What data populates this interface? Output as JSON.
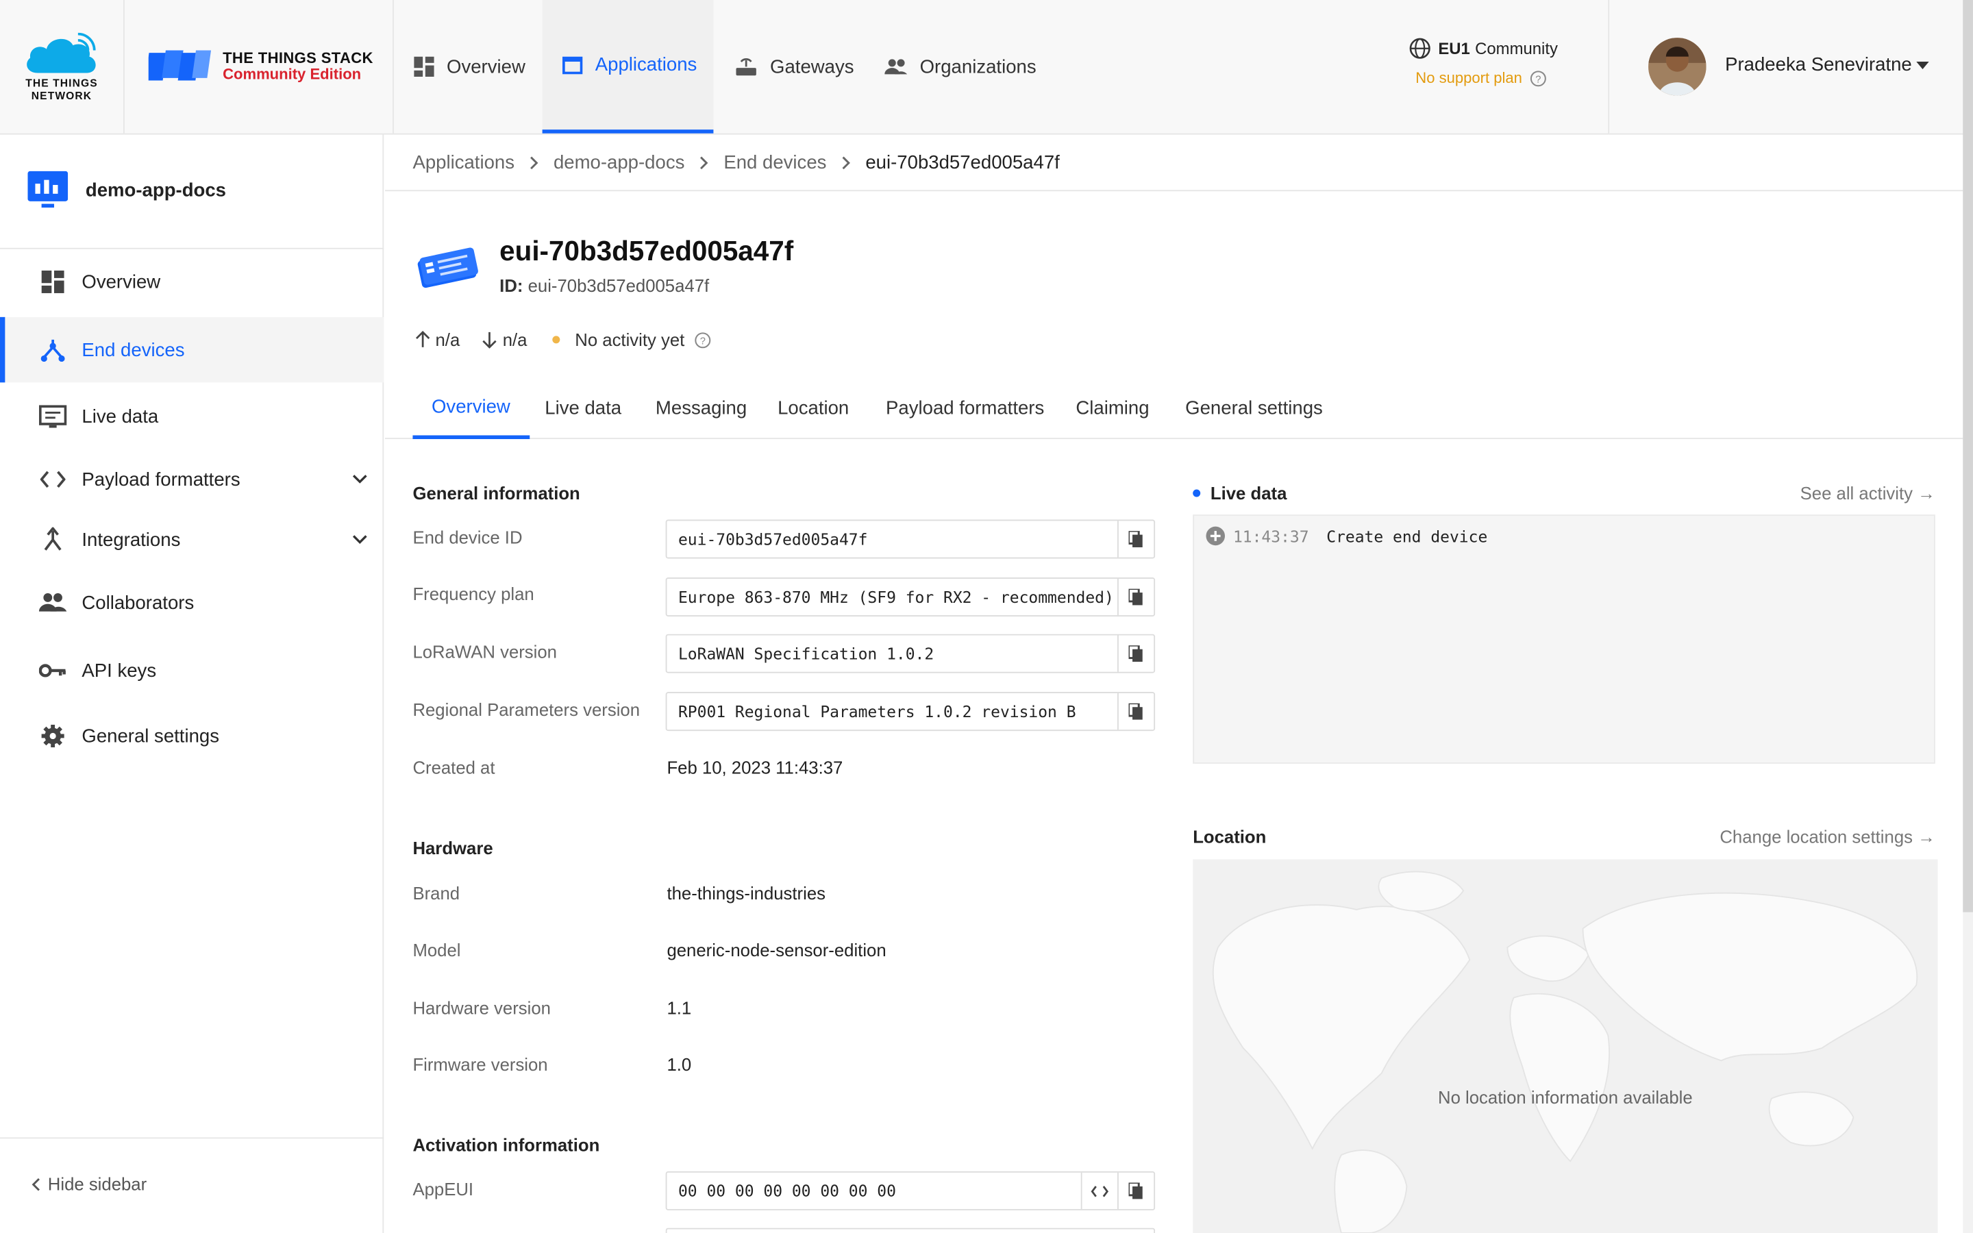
{
  "header": {
    "ttn_logo_text": "THE THINGS\nNETWORK",
    "tts_name": "THE THINGS STACK",
    "tts_edition": "Community Edition",
    "nav": [
      {
        "label": "Overview",
        "icon": "overview-grid-icon"
      },
      {
        "label": "Applications",
        "icon": "application-window-icon",
        "active": true
      },
      {
        "label": "Gateways",
        "icon": "gateway-router-icon"
      },
      {
        "label": "Organizations",
        "icon": "organization-people-icon"
      }
    ],
    "cluster": {
      "region": "EU1",
      "label": "Community",
      "support": "No support plan"
    },
    "user": {
      "name": "Pradeeka Seneviratne"
    }
  },
  "sidebar": {
    "app_name": "demo-app-docs",
    "items": [
      {
        "label": "Overview",
        "icon": "overview-grid-icon"
      },
      {
        "label": "End devices",
        "icon": "end-devices-icon",
        "active": true
      },
      {
        "label": "Live data",
        "icon": "live-data-icon"
      },
      {
        "label": "Payload formatters",
        "icon": "code-icon",
        "expandable": true
      },
      {
        "label": "Integrations",
        "icon": "integrations-icon",
        "expandable": true
      },
      {
        "label": "Collaborators",
        "icon": "collaborators-icon"
      },
      {
        "label": "API keys",
        "icon": "key-icon"
      },
      {
        "label": "General settings",
        "icon": "gear-icon"
      }
    ],
    "hide_label": "Hide sidebar"
  },
  "breadcrumb": [
    "Applications",
    "demo-app-docs",
    "End devices",
    "eui-70b3d57ed005a47f"
  ],
  "device": {
    "title": "eui-70b3d57ed005a47f",
    "id_label": "ID:",
    "id_value": "eui-70b3d57ed005a47f",
    "uplink": "n/a",
    "downlink": "n/a",
    "activity": "No activity yet"
  },
  "tabs": [
    "Overview",
    "Live data",
    "Messaging",
    "Location",
    "Payload formatters",
    "Claiming",
    "General settings"
  ],
  "general": {
    "title": "General information",
    "end_device_id_label": "End device ID",
    "end_device_id": "eui-70b3d57ed005a47f",
    "frequency_plan_label": "Frequency plan",
    "frequency_plan": "Europe 863-870 MHz (SF9 for RX2 - recommended)",
    "lorawan_version_label": "LoRaWAN version",
    "lorawan_version": "LoRaWAN Specification 1.0.2",
    "regional_label": "Regional Parameters version",
    "regional": "RP001 Regional Parameters 1.0.2 revision B",
    "created_label": "Created at",
    "created": "Feb 10, 2023 11:43:37"
  },
  "hardware": {
    "title": "Hardware",
    "brand_label": "Brand",
    "brand": "the-things-industries",
    "model_label": "Model",
    "model": "generic-node-sensor-edition",
    "hw_label": "Hardware version",
    "hw": "1.1",
    "fw_label": "Firmware version",
    "fw": "1.0"
  },
  "activation": {
    "title": "Activation information",
    "appeui_label": "AppEUI",
    "appeui": "00 00 00 00 00 00 00 00"
  },
  "live": {
    "title": "Live data",
    "see_all": "See all activity →",
    "event_time": "11:43:37",
    "event_msg": "Create end device"
  },
  "location": {
    "title": "Location",
    "change": "Change location settings →",
    "empty": "No location information available"
  },
  "colors": {
    "accent": "#1464fa",
    "warning": "#e39b0e",
    "brand_red": "#d9232e"
  }
}
